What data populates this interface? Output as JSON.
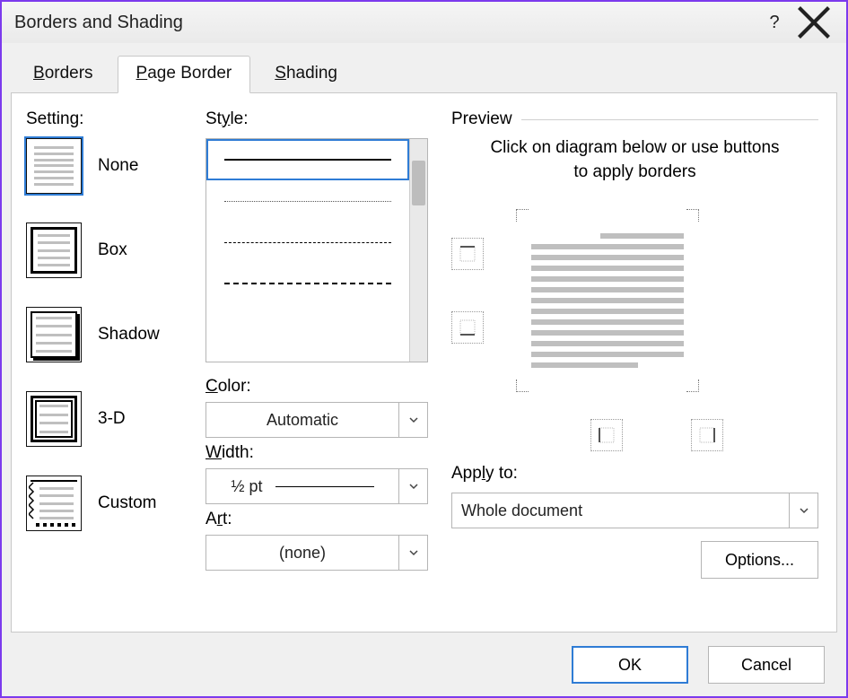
{
  "title": "Borders and Shading",
  "tabs": {
    "borders": "Borders",
    "page_border": "Page Border",
    "shading": "Shading"
  },
  "setting": {
    "label": "Setting:",
    "none": "None",
    "box": "Box",
    "shadow": "Shadow",
    "threeD": "3-D",
    "custom": "Custom"
  },
  "style": {
    "label": "Style:",
    "color_label": "Color:",
    "color_value": "Automatic",
    "width_label": "Width:",
    "width_value": "½ pt",
    "art_label": "Art:",
    "art_value": "(none)"
  },
  "preview": {
    "label": "Preview",
    "hint": "Click on diagram below or use buttons to apply borders"
  },
  "apply": {
    "label": "Apply to:",
    "value": "Whole document"
  },
  "buttons": {
    "options": "Options...",
    "ok": "OK",
    "cancel": "Cancel"
  }
}
